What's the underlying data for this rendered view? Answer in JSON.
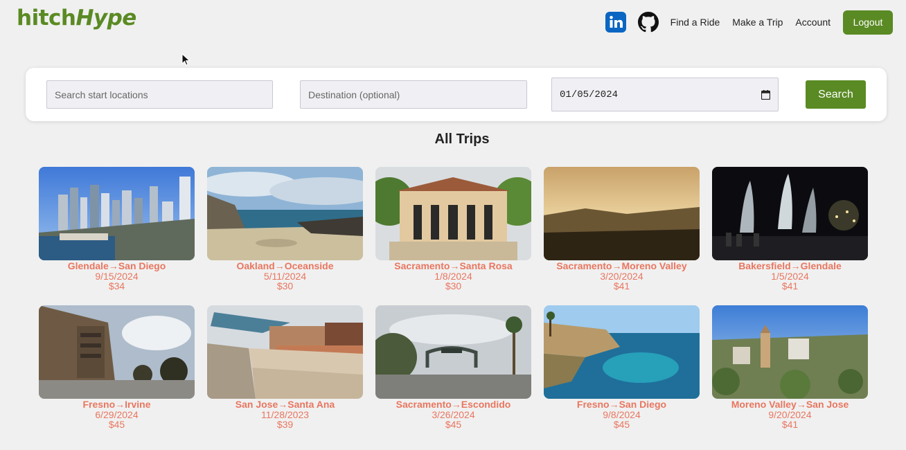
{
  "brand": {
    "part1": "hitch",
    "part2": "Hype"
  },
  "nav": {
    "linkedin_icon": "linkedin-icon",
    "github_icon": "github-icon",
    "find_ride": "Find a Ride",
    "make_trip": "Make a Trip",
    "account": "Account",
    "logout": "Logout"
  },
  "search": {
    "start_placeholder": "Search start locations",
    "dest_placeholder": "Destination (optional)",
    "date_value": "01/05/2024",
    "calendar_icon": "calendar-icon",
    "button": "Search"
  },
  "section_title": "All Trips",
  "colors": {
    "brand_green": "#5a8a24",
    "trip_text": "#e8765f",
    "background": "#f0f0f0"
  },
  "trips": [
    {
      "route": "Glendale→San Diego",
      "date": "9/15/2024",
      "price": "$34",
      "scene": "city-skyline"
    },
    {
      "route": "Oakland→Oceanside",
      "date": "5/11/2024",
      "price": "$30",
      "scene": "beach-rocks"
    },
    {
      "route": "Sacramento→Santa Rosa",
      "date": "1/8/2024",
      "price": "$30",
      "scene": "station-building"
    },
    {
      "route": "Sacramento→Moreno Valley",
      "date": "3/20/2024",
      "price": "$41",
      "scene": "sunset-valley"
    },
    {
      "route": "Bakersfield→Glendale",
      "date": "1/5/2024",
      "price": "$41",
      "scene": "night-fountain"
    },
    {
      "route": "Fresno→Irvine",
      "date": "6/29/2024",
      "price": "$45",
      "scene": "office-building"
    },
    {
      "route": "San Jose→Santa Ana",
      "date": "11/28/2023",
      "price": "$39",
      "scene": "street-sidewalk"
    },
    {
      "route": "Sacramento→Escondido",
      "date": "3/26/2024",
      "price": "$45",
      "scene": "town-arch"
    },
    {
      "route": "Fresno→San Diego",
      "date": "9/8/2024",
      "price": "$45",
      "scene": "coast-cove"
    },
    {
      "route": "Moreno Valley→San Jose",
      "date": "9/20/2024",
      "price": "$41",
      "scene": "aerial-city"
    }
  ]
}
